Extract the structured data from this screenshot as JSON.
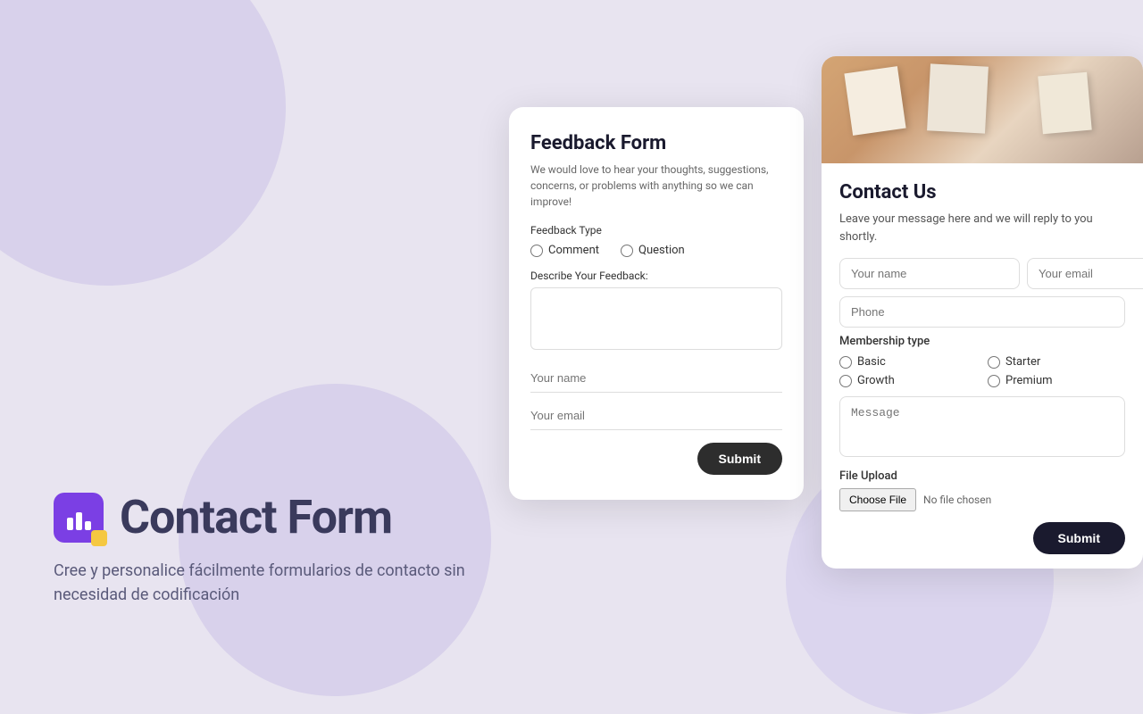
{
  "background": {
    "color": "#e8e4f0"
  },
  "brand": {
    "title": "Contact Form",
    "subtitle": "Cree y personalice fácilmente formularios de contacto sin necesidad de codificación",
    "icon_alt": "Jotform icon"
  },
  "feedback_form": {
    "title": "Feedback Form",
    "description": "We would love to hear your thoughts, suggestions, concerns, or problems with anything so we can improve!",
    "feedback_type_label": "Feedback Type",
    "radio_options": [
      {
        "value": "comment",
        "label": "Comment"
      },
      {
        "value": "question",
        "label": "Question"
      }
    ],
    "textarea_label": "Describe Your Feedback:",
    "textarea_placeholder": "",
    "name_placeholder": "Your name",
    "email_placeholder": "Your email",
    "submit_label": "Submit"
  },
  "contact_form": {
    "title": "Contact Us",
    "description": "Leave your message here and we will reply to you shortly.",
    "name_placeholder": "Your name",
    "email_placeholder": "Your email",
    "phone_placeholder": "Phone",
    "membership_label": "Membership type",
    "membership_options": [
      {
        "value": "basic",
        "label": "Basic"
      },
      {
        "value": "starter",
        "label": "Starter"
      },
      {
        "value": "growth",
        "label": "Growth"
      },
      {
        "value": "premium",
        "label": "Premium"
      }
    ],
    "message_placeholder": "Message",
    "file_upload_label": "File Upload",
    "choose_file_label": "Choose File",
    "no_file_text": "No file chosen",
    "submit_label": "Submit"
  }
}
